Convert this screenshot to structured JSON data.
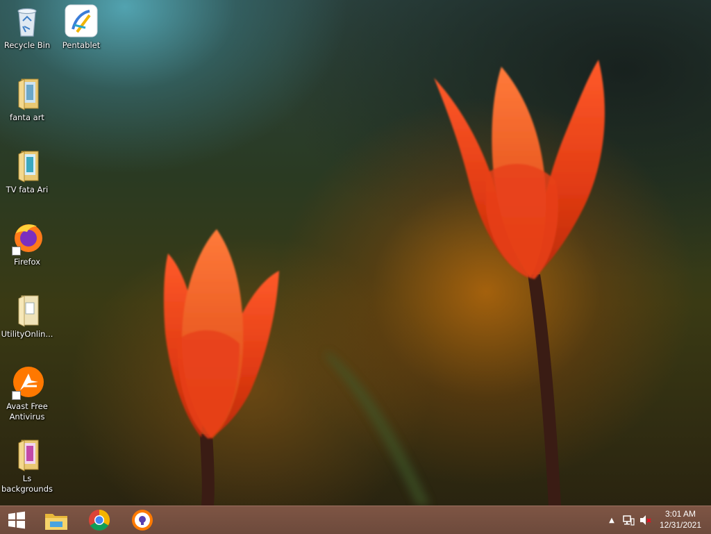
{
  "desktop": {
    "icons": [
      {
        "label": "Recycle Bin",
        "icon": "recycle-bin-icon"
      },
      {
        "label": "Pentablet",
        "icon": "pentablet-icon"
      },
      {
        "label": "fanta art",
        "icon": "folder-icon"
      },
      {
        "label": "TV  fata Ari",
        "icon": "folder-icon"
      },
      {
        "label": "Firefox",
        "icon": "firefox-icon"
      },
      {
        "label": "UtilityOnlin...",
        "icon": "folder-icon"
      },
      {
        "label": "Avast Free Antivirus",
        "icon": "avast-icon"
      },
      {
        "label": "Ls backgrounds",
        "icon": "folder-icon"
      }
    ]
  },
  "taskbar": {
    "pinned": [
      {
        "name": "File Explorer",
        "icon": "file-explorer-icon"
      },
      {
        "name": "Google Chrome",
        "icon": "chrome-icon"
      },
      {
        "name": "Avast Secure Browser",
        "icon": "avast-secure-browser-icon"
      }
    ],
    "tray": {
      "icons": [
        "show-hidden-icons-chevron",
        "network-icon",
        "volume-muted-icon"
      ]
    },
    "clock": {
      "time": "3:01 AM",
      "date": "12/31/2021"
    }
  },
  "colors": {
    "taskbar": "#6d4a3c",
    "tulip": "#e8401a",
    "wallpaper_dark": "#2a2410"
  }
}
